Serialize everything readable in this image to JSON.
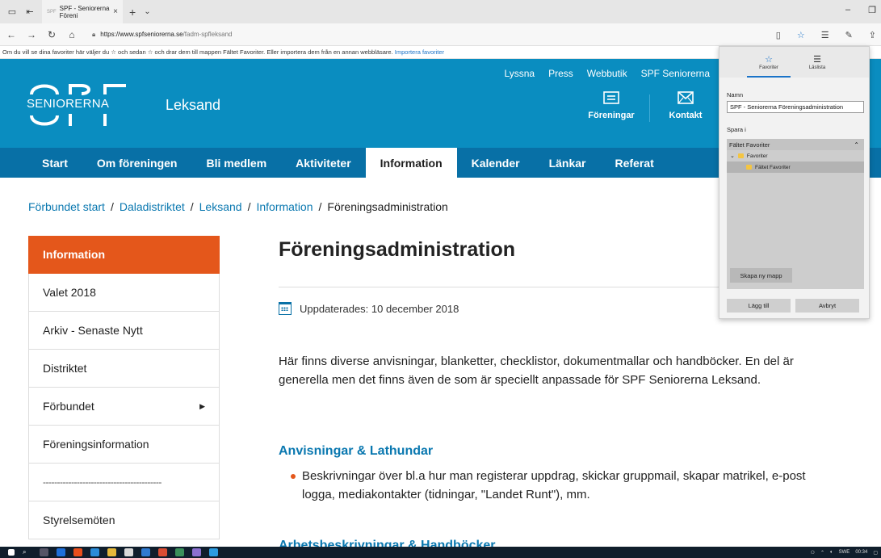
{
  "browser": {
    "tab_title": "SPF - Seniorerna Föreni",
    "tab_favicon_text": "SPF",
    "tab_close": "×",
    "tab_new": "+",
    "tab_more": "⌄",
    "url_domain": "https://www.spfseniorerna.se",
    "url_path": "/fadm-spfleksand",
    "favorites_note": "Om du vill se dina favoriter här väljer du ☆ och sedan ☆ och drar dem till mappen Fältet Favoriter. Eller importera dem från en annan webbläsare.",
    "favorites_note_link": "Importera favoriter"
  },
  "site": {
    "top_nav": [
      "Lyssna",
      "Press",
      "Webbutik",
      "SPF Seniorerna"
    ],
    "logo_text": "SENIORERNA",
    "site_name": "Leksand",
    "header_icons": [
      {
        "label": "Föreningar",
        "icon": "list-icon"
      },
      {
        "label": "Kontakt",
        "icon": "mail-icon"
      }
    ],
    "main_nav": [
      "Start",
      "Om föreningen",
      "Bli medlem",
      "Aktiviteter",
      "Information",
      "Kalender",
      "Länkar",
      "Referat"
    ],
    "main_nav_active": "Information"
  },
  "breadcrumb": {
    "items": [
      "Förbundet start",
      "Daladistriktet",
      "Leksand",
      "Information"
    ],
    "current": "Föreningsadministration",
    "separator": "/"
  },
  "sidebar": {
    "items": [
      "Information",
      "Valet 2018",
      "Arkiv - Senaste Nytt",
      "Distriktet",
      "Förbundet",
      "Föreningsinformation",
      "------------------------------------------",
      "Styrelsemöten"
    ],
    "active": "Information",
    "expandable": "Förbundet"
  },
  "content": {
    "title": "Föreningsadministration",
    "updated": "Uppdaterades: 10 december 2018",
    "intro": "Här finns diverse anvisningar, blanketter, checklistor, dokumentmallar och handböcker. En del är generella men det finns även de som är speciellt anpassade för SPF Seniorerna Leksand.",
    "section1_title": "Anvisningar & Lathundar",
    "section1_bullet": "Beskrivningar över bl.a hur man registerar uppdrag, skickar gruppmail, skapar matrikel, e-post logga, mediakontakter (tidningar, \"Landet Runt\"), mm.",
    "section2_title": "Arbetsbeskrivningar & Handböcker"
  },
  "flyout": {
    "tab_favorites": "Favoriter",
    "tab_readinglist": "Läslista",
    "name_label": "Namn",
    "name_value": "SPF - Seniorerna Föreningsadministration",
    "save_in_label": "Spara i",
    "tree_header": "Fältet Favoriter",
    "tree_items": [
      "Favoriter",
      "Fältet Favoriter"
    ],
    "new_folder": "Skapa ny mapp",
    "add_button": "Lägg till",
    "cancel_button": "Avbryt"
  },
  "taskbar": {
    "language": "SWE",
    "time": "00:34"
  },
  "colors": {
    "header_blue": "#0a8dc0",
    "nav_blue": "#0870a6",
    "accent_orange": "#e4571b",
    "link_blue": "#0a78b0"
  }
}
